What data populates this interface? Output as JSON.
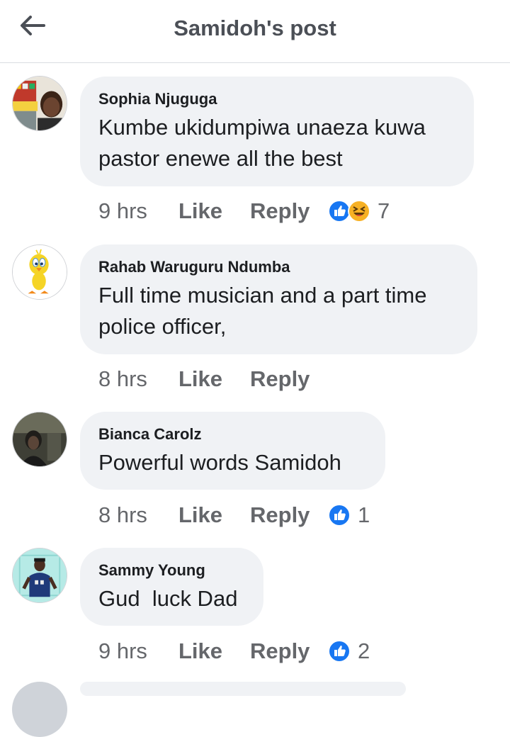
{
  "header": {
    "title": "Samidoh's post"
  },
  "comments": [
    {
      "name": "Sophia Njuguga",
      "text": "Kumbe ukidumpiwa unaeza kuwa pastor enewe all the best",
      "time": "9 hrs",
      "like": "Like",
      "reply": "Reply",
      "reactions": [
        "like-icon",
        "haha-icon"
      ],
      "count": "7"
    },
    {
      "name": "Rahab Waruguru Ndumba",
      "text": "Full time musician and a part time police officer,",
      "time": "8 hrs",
      "like": "Like",
      "reply": "Reply",
      "reactions": [],
      "count": ""
    },
    {
      "name": "Bianca Carolz",
      "text": "Powerful words Samidoh",
      "time": "8 hrs",
      "like": "Like",
      "reply": "Reply",
      "reactions": [
        "like-icon"
      ],
      "count": "1"
    },
    {
      "name": "Sammy Young",
      "text": "Gud  luck Dad",
      "time": "9 hrs",
      "like": "Like",
      "reply": "Reply",
      "reactions": [
        "like-icon"
      ],
      "count": "2"
    }
  ],
  "colors": {
    "accent": "#1877f2",
    "bubble": "#f0f2f5",
    "secondary_text": "#65676b"
  }
}
